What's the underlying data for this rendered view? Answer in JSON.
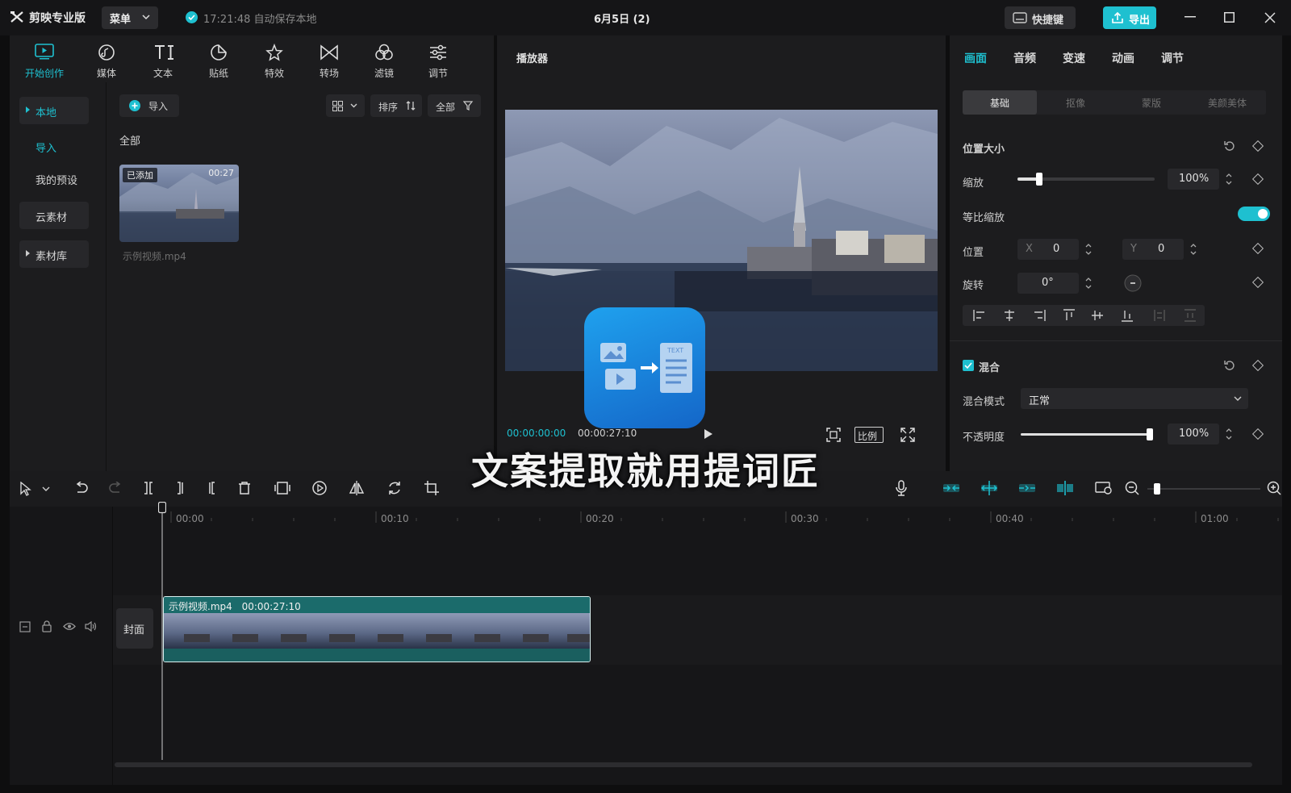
{
  "app": {
    "name": "剪映专业版",
    "menu_label": "菜单",
    "save_status": "17:21:48 自动保存本地",
    "doc_title": "6月5日 (2)",
    "hotkey_label": "快捷键",
    "export_label": "导出"
  },
  "toolbar_tabs": [
    {
      "label": "开始创作",
      "icon": "start-creation-icon",
      "active": true
    },
    {
      "label": "媒体",
      "icon": "media-icon"
    },
    {
      "label": "文本",
      "icon": "text-icon"
    },
    {
      "label": "贴纸",
      "icon": "sticker-icon"
    },
    {
      "label": "特效",
      "icon": "effects-icon"
    },
    {
      "label": "转场",
      "icon": "transition-icon"
    },
    {
      "label": "滤镜",
      "icon": "filter-icon"
    },
    {
      "label": "调节",
      "icon": "adjust-icon"
    }
  ],
  "sidebar": {
    "items": [
      {
        "label": "本地",
        "active": true
      },
      {
        "label": "导入",
        "active": true
      },
      {
        "label": "我的预设"
      },
      {
        "label": "云素材"
      },
      {
        "label": "素材库"
      }
    ]
  },
  "media": {
    "import_label": "导入",
    "sort_label": "排序",
    "filter_label": "全部",
    "section_label": "全部",
    "clip": {
      "badge": "已添加",
      "duration": "00:27",
      "filename": "示例视频.mp4"
    }
  },
  "player": {
    "title": "播放器",
    "time_current": "00:00:00:00",
    "time_total": "00:00:27:10",
    "ratio_label": "比例"
  },
  "props": {
    "tabs": [
      "画面",
      "音频",
      "变速",
      "动画",
      "调节"
    ],
    "segments": [
      "基础",
      "抠像",
      "蒙版",
      "美颜美体"
    ],
    "position_size_label": "位置大小",
    "scale_label": "缩放",
    "scale_value": "100%",
    "scale_level": 0.16,
    "uniform_scale_label": "等比缩放",
    "position_label": "位置",
    "pos_x_label": "X",
    "pos_x": "0",
    "pos_y_label": "Y",
    "pos_y": "0",
    "rotate_label": "旋转",
    "rotate_value": "0°",
    "blend_label": "混合",
    "blend_mode_label": "混合模式",
    "blend_mode_value": "正常",
    "opacity_label": "不透明度",
    "opacity_value": "100%",
    "opacity_level": 1.0
  },
  "timeline": {
    "ruler": [
      "00:00",
      "00:10",
      "00:20",
      "00:30",
      "00:40",
      "01:00"
    ],
    "cover_label": "封面",
    "clip_name": "示例视频.mp4",
    "clip_duration": "00:00:27:10"
  },
  "overlay": {
    "caption": "文案提取就用提词匠",
    "icon_text": "TEXT"
  },
  "colors": {
    "accent": "#1ec0d0",
    "background": "#0e0e0f",
    "panel": "#1c1c1e",
    "clip_header": "#1b6b6b"
  }
}
